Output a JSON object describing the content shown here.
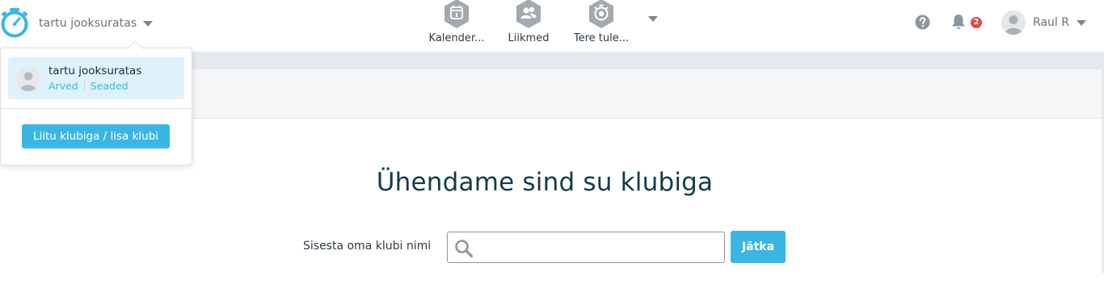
{
  "header": {
    "club_name": "tartu jooksuratas",
    "nav": [
      {
        "label": "Kalender...",
        "icon": "calendar-icon"
      },
      {
        "label": "Liikmed",
        "icon": "members-icon"
      },
      {
        "label": "Tere tule...",
        "icon": "stopwatch-icon"
      }
    ],
    "notifications_count": "2",
    "user_name": "Raul R"
  },
  "dropdown": {
    "club_title": "tartu jooksuratas",
    "link_invoices": "Arved",
    "link_settings": "Seaded",
    "join_button": "Liitu klubiga / lisa klubi"
  },
  "main": {
    "heading": "Ühendame sind su klubiga",
    "search_label": "Sisesta oma klubi nimi",
    "search_value": "",
    "continue_button": "Jätka"
  },
  "colors": {
    "accent": "#3ab6e4",
    "heading": "#123b4d",
    "badge": "#e84545",
    "nav_icon": "#a2aab0"
  }
}
